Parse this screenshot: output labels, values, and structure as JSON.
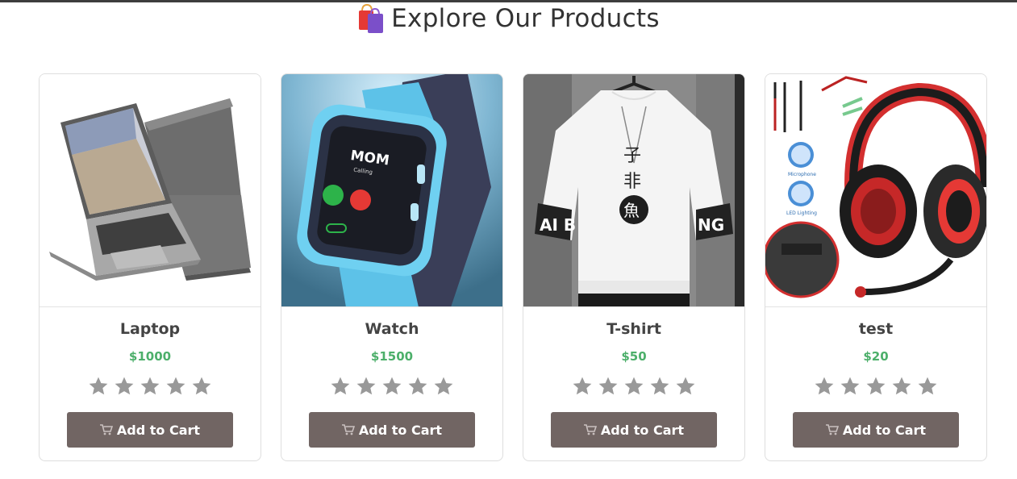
{
  "page": {
    "title": "Explore Our Products",
    "title_icon": "shopping-bags-icon"
  },
  "products": [
    {
      "name": "Laptop",
      "price": "$1000",
      "rating": 0,
      "max_rating": 5,
      "button_label": "Add to Cart",
      "image": "laptop-image"
    },
    {
      "name": "Watch",
      "price": "$1500",
      "rating": 0,
      "max_rating": 5,
      "button_label": "Add to Cart",
      "image": "smartwatch-image"
    },
    {
      "name": "T-shirt",
      "price": "$50",
      "rating": 0,
      "max_rating": 5,
      "button_label": "Add to Cart",
      "image": "tshirt-image"
    },
    {
      "name": "test",
      "price": "$20",
      "rating": 0,
      "max_rating": 5,
      "button_label": "Add to Cart",
      "image": "headset-image"
    }
  ],
  "colors": {
    "price": "#4caf6a",
    "button": "#716563",
    "star": "#999999"
  }
}
